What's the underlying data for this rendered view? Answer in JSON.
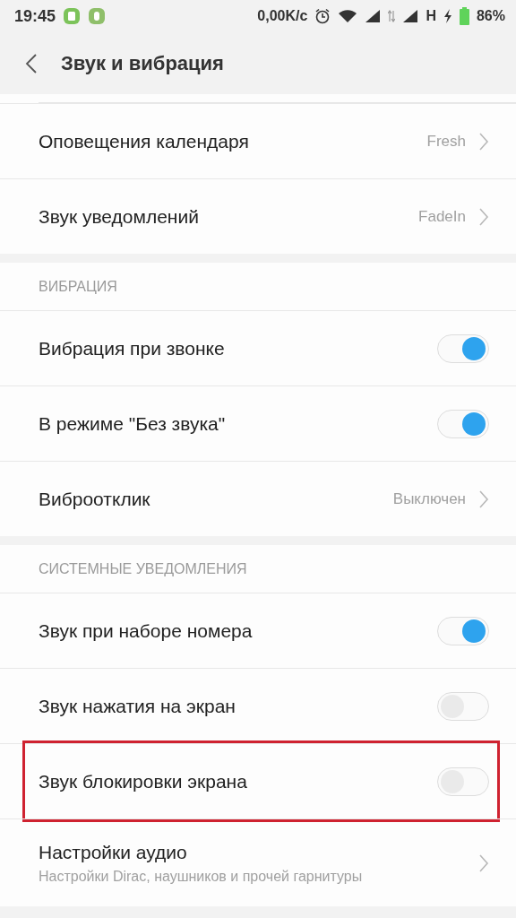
{
  "status_bar": {
    "time": "19:45",
    "speed": "0,00K/c",
    "network_type": "H",
    "battery": "86%"
  },
  "header": {
    "title": "Звук и вибрация"
  },
  "sections": [
    {
      "rows": [
        {
          "kind": "link",
          "title": "Оповещения календаря",
          "value": "Fresh"
        },
        {
          "kind": "link",
          "title": "Звук уведомлений",
          "value": "FadeIn"
        }
      ]
    },
    {
      "title": "ВИБРАЦИЯ",
      "rows": [
        {
          "kind": "toggle",
          "title": "Вибрация при звонке",
          "on": true
        },
        {
          "kind": "toggle",
          "title": "В режиме \"Без звука\"",
          "on": true
        },
        {
          "kind": "link",
          "title": "Виброотклик",
          "value": "Выключен"
        }
      ]
    },
    {
      "title": "СИСТЕМНЫЕ УВЕДОМЛЕНИЯ",
      "rows": [
        {
          "kind": "toggle",
          "title": "Звук при наборе номера",
          "on": true
        },
        {
          "kind": "toggle",
          "title": "Звук нажатия на экран",
          "on": false
        },
        {
          "kind": "toggle",
          "title": "Звук блокировки экрана",
          "on": false,
          "highlighted": true
        },
        {
          "kind": "link",
          "title": "Настройки аудио",
          "subtitle": "Настройки Dirac, наушников и прочей гарнитуры"
        }
      ]
    }
  ]
}
